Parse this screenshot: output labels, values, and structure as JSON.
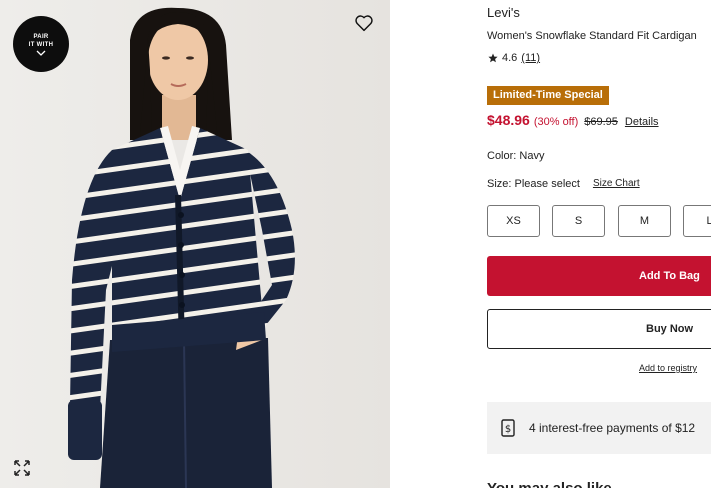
{
  "image_panel": {
    "pair_badge_line1": "PAIR",
    "pair_badge_line2": "IT WITH",
    "icons": {
      "wishlist": "heart-outline-icon",
      "pair_chevron": "chevron-down-icon",
      "expand": "expand-arrows-icon"
    }
  },
  "product": {
    "brand": "Levi's",
    "name": "Women's Snowflake Standard Fit Cardigan",
    "rating": "4.6",
    "review_count": "(11)",
    "promo_badge": "Limited-Time Special",
    "sale_price": "$48.96",
    "discount": "(30% off)",
    "original_price": "$69.95",
    "details_link": "Details",
    "color_label": "Color: Navy",
    "size_label": "Size: Please select",
    "size_chart_link": "Size Chart",
    "sizes": [
      "XS",
      "S",
      "M",
      "L"
    ],
    "add_to_bag": "Add To Bag",
    "buy_now": "Buy Now",
    "registry_link": "Add to registry",
    "payments_text": "4 interest-free payments of $12",
    "cutoff_heading": "You may also like"
  },
  "colors": {
    "accent_red": "#c41230",
    "promo_orange": "#b86e08",
    "sweater_navy": "#1c2740",
    "image_bg": "#ebe9e6"
  }
}
